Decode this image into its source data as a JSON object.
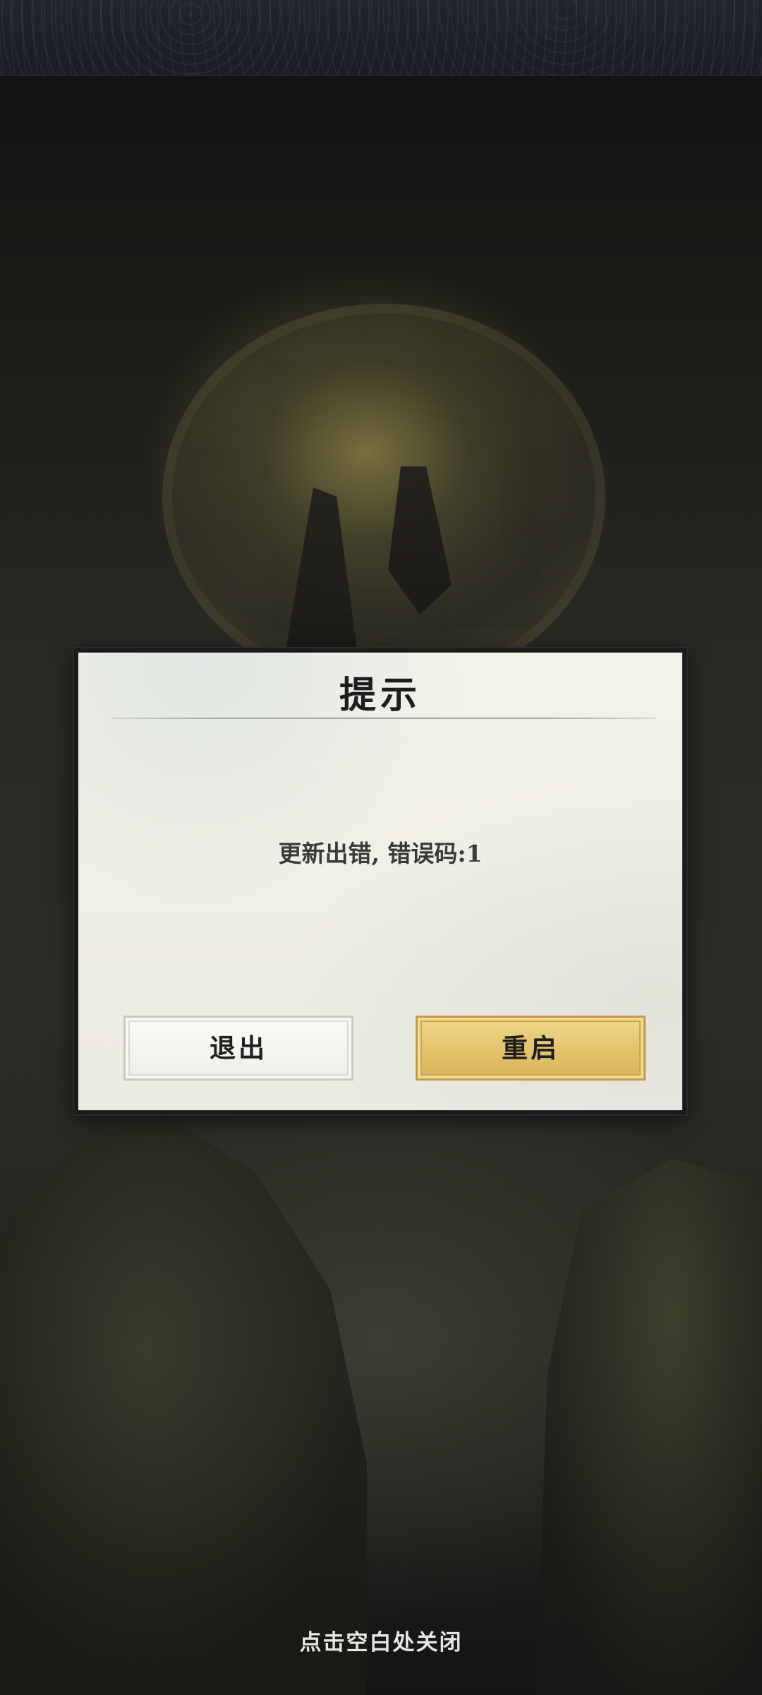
{
  "dialog": {
    "title": "提示",
    "message": "更新出错, 错误码:1",
    "buttons": {
      "exit_label": "退出",
      "restart_label": "重启"
    }
  },
  "footer": {
    "close_hint": "点击空白处关闭"
  },
  "colors": {
    "dialog_bg": "#f1f0e7",
    "dialog_border": "#1b1b1b",
    "primary_button": "#e2c36c",
    "secondary_button": "#f4f4f0",
    "hint_text": "#e6e6e2"
  }
}
